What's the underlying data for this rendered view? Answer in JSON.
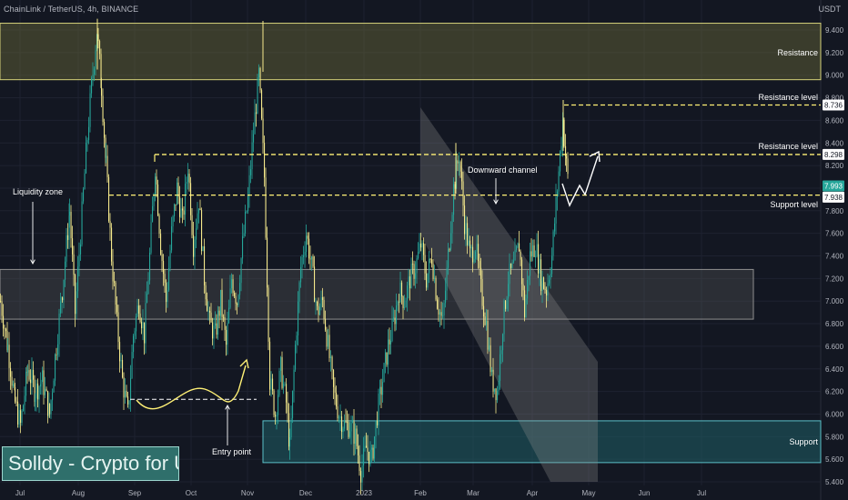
{
  "header": {
    "symbol": "ChainLink / TetherUS, 4h, BINANCE",
    "currency": "USDT"
  },
  "watermark": "Solldy - Crypto for U",
  "colors": {
    "background": "#131722",
    "up_candle": "#26a69a",
    "down_candle": "#f5e98c",
    "annotation": "#fff176",
    "zone_fill": "#6b6b3a",
    "support_fill": "#1f5f66",
    "support_border": "#5bc0c8"
  },
  "chart_data": {
    "type": "candlestick",
    "title": "ChainLink / TetherUS, 4h, BINANCE",
    "ylabel": "USDT",
    "ylim": [
      5.4,
      9.6
    ],
    "y_ticks": [
      "5.400",
      "5.600",
      "5.800",
      "6.000",
      "6.200",
      "6.400",
      "6.600",
      "6.800",
      "7.000",
      "7.200",
      "7.400",
      "7.600",
      "7.800",
      "8.000",
      "8.200",
      "8.400",
      "8.600",
      "8.800",
      "9.000",
      "9.200",
      "9.400",
      "USDT"
    ],
    "x_ticks": [
      "Jul",
      "Aug",
      "Sep",
      "Oct",
      "Nov",
      "Dec",
      "2023",
      "Feb",
      "Mar",
      "Apr",
      "May",
      "Jun",
      "Jul"
    ],
    "price_path": [
      [
        0,
        7.0
      ],
      [
        8,
        6.6
      ],
      [
        16,
        6.1
      ],
      [
        22,
        5.9
      ],
      [
        30,
        6.4
      ],
      [
        38,
        6.2
      ],
      [
        46,
        6.3
      ],
      [
        54,
        6.0
      ],
      [
        60,
        6.5
      ],
      [
        68,
        7.1
      ],
      [
        76,
        7.8
      ],
      [
        82,
        6.9
      ],
      [
        88,
        7.6
      ],
      [
        94,
        8.3
      ],
      [
        100,
        8.9
      ],
      [
        106,
        9.4
      ],
      [
        111,
        8.9
      ],
      [
        116,
        8.2
      ],
      [
        122,
        7.4
      ],
      [
        128,
        6.8
      ],
      [
        134,
        6.3
      ],
      [
        140,
        6.0
      ],
      [
        146,
        6.7
      ],
      [
        152,
        7.0
      ],
      [
        158,
        6.7
      ],
      [
        164,
        7.4
      ],
      [
        170,
        8.2
      ],
      [
        176,
        7.5
      ],
      [
        182,
        7.0
      ],
      [
        188,
        7.6
      ],
      [
        194,
        8.0
      ],
      [
        200,
        7.7
      ],
      [
        206,
        8.2
      ],
      [
        212,
        7.5
      ],
      [
        218,
        7.9
      ],
      [
        224,
        7.2
      ],
      [
        230,
        6.8
      ],
      [
        236,
        6.7
      ],
      [
        242,
        7.0
      ],
      [
        248,
        6.6
      ],
      [
        254,
        7.2
      ],
      [
        260,
        7.0
      ],
      [
        266,
        7.5
      ],
      [
        272,
        7.9
      ],
      [
        278,
        8.5
      ],
      [
        284,
        9.0
      ],
      [
        290,
        8.1
      ],
      [
        296,
        6.3
      ],
      [
        302,
        6.0
      ],
      [
        308,
        6.4
      ],
      [
        314,
        6.1
      ],
      [
        318,
        5.7
      ],
      [
        324,
        6.6
      ],
      [
        330,
        7.3
      ],
      [
        336,
        7.6
      ],
      [
        342,
        7.3
      ],
      [
        348,
        6.9
      ],
      [
        354,
        7.0
      ],
      [
        360,
        6.6
      ],
      [
        366,
        6.2
      ],
      [
        372,
        6.0
      ],
      [
        378,
        5.9
      ],
      [
        384,
        5.9
      ],
      [
        390,
        5.8
      ],
      [
        396,
        5.5
      ],
      [
        402,
        5.7
      ],
      [
        408,
        5.6
      ],
      [
        414,
        6.0
      ],
      [
        420,
        6.3
      ],
      [
        426,
        6.6
      ],
      [
        432,
        6.8
      ],
      [
        438,
        7.1
      ],
      [
        444,
        7.0
      ],
      [
        450,
        7.2
      ],
      [
        456,
        7.3
      ],
      [
        462,
        7.5
      ],
      [
        468,
        7.2
      ],
      [
        474,
        7.4
      ],
      [
        480,
        7.0
      ],
      [
        486,
        6.8
      ],
      [
        492,
        7.4
      ],
      [
        498,
        8.0
      ],
      [
        504,
        8.3
      ],
      [
        510,
        7.7
      ],
      [
        516,
        7.4
      ],
      [
        522,
        7.5
      ],
      [
        528,
        7.1
      ],
      [
        534,
        6.8
      ],
      [
        540,
        6.3
      ],
      [
        546,
        6.2
      ],
      [
        552,
        6.8
      ],
      [
        558,
        7.2
      ],
      [
        564,
        7.3
      ],
      [
        570,
        7.5
      ],
      [
        576,
        6.9
      ],
      [
        582,
        7.4
      ],
      [
        588,
        7.5
      ],
      [
        594,
        7.2
      ],
      [
        600,
        7.1
      ],
      [
        606,
        7.4
      ],
      [
        612,
        8.0
      ],
      [
        618,
        8.6
      ],
      [
        622,
        8.2
      ],
      [
        625,
        7.99
      ]
    ],
    "annotations": [
      {
        "label": "Resistance",
        "kind": "zone",
        "y_range": [
          8.96,
          9.46
        ]
      },
      {
        "label": "Resistance level",
        "kind": "line",
        "y": 8.736
      },
      {
        "label": "Resistance level",
        "kind": "line",
        "y": 8.298
      },
      {
        "label": "Support level",
        "kind": "line",
        "y": 7.938
      },
      {
        "label": "Liquidity zone",
        "kind": "zone",
        "y_range": [
          6.84,
          7.28
        ]
      },
      {
        "label": "Support",
        "kind": "zone",
        "y_range": [
          5.57,
          5.94
        ]
      },
      {
        "label": "Downward channel",
        "kind": "channel"
      },
      {
        "label": "Entry point",
        "kind": "marker",
        "y": 6.13
      }
    ],
    "price_labels": [
      {
        "value": "8.736",
        "style": "light"
      },
      {
        "value": "8.298",
        "style": "light"
      },
      {
        "value": "7.993",
        "style": "current"
      },
      {
        "value": "7.938",
        "style": "light"
      }
    ]
  }
}
